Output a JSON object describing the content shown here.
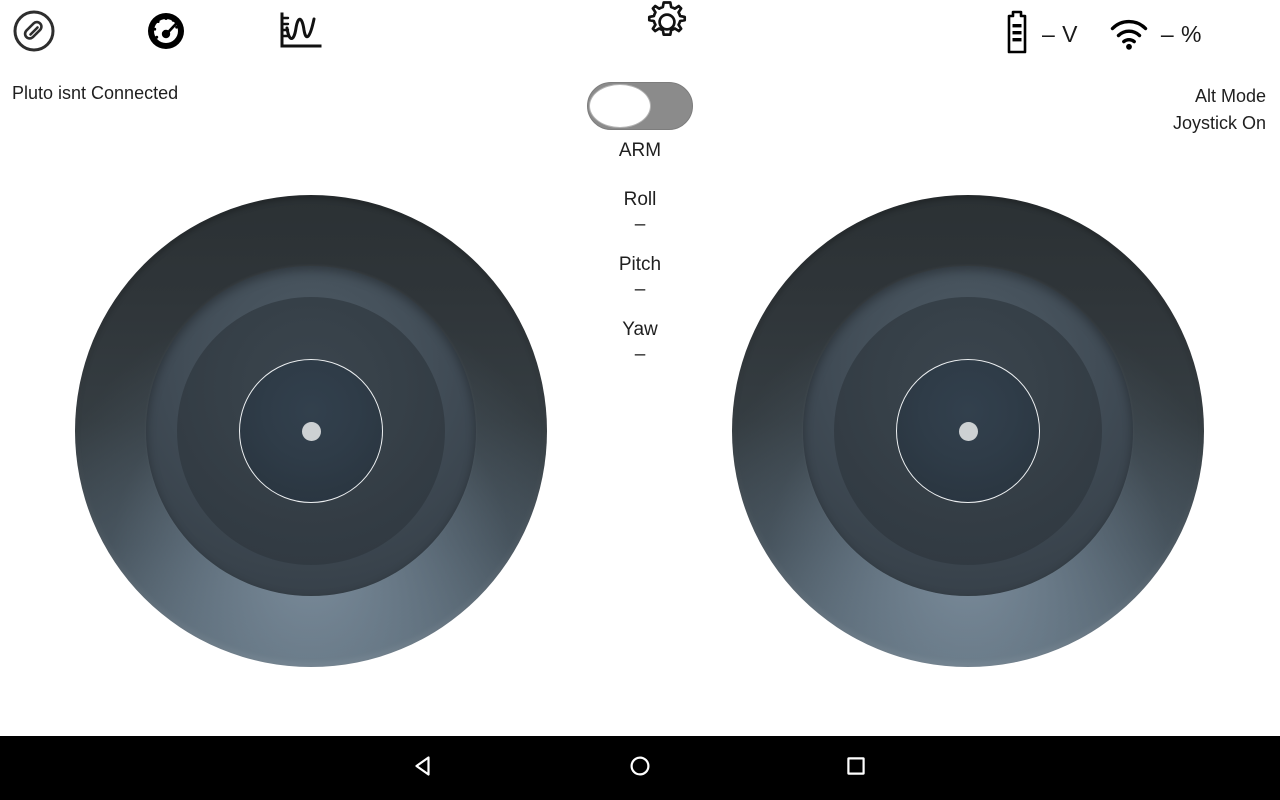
{
  "topbar": {
    "icons": [
      {
        "name": "connect-icon",
        "label": "Connect"
      },
      {
        "name": "gauge-icon",
        "label": "Telemetry Gauge"
      },
      {
        "name": "graph-icon",
        "label": "Graph"
      }
    ],
    "battery": {
      "icon": "battery-icon",
      "value": "– V"
    },
    "signal": {
      "icon": "wifi-icon",
      "value": "– %"
    },
    "settings": {
      "icon": "gear-icon",
      "label": "Settings"
    }
  },
  "status": {
    "connection": "Pluto isnt Connected",
    "mode_line1": "Alt Mode",
    "mode_line2": "Joystick On"
  },
  "arm": {
    "label": "ARM",
    "state": "off"
  },
  "telemetry": [
    {
      "name": "Roll",
      "value": "–"
    },
    {
      "name": "Pitch",
      "value": "–"
    },
    {
      "name": "Yaw",
      "value": "–"
    }
  ],
  "joysticks": [
    {
      "id": "left",
      "name": "left-joystick",
      "dot_x": 0,
      "dot_y": 0
    },
    {
      "id": "right",
      "name": "right-joystick",
      "dot_x": 0,
      "dot_y": 0
    }
  ],
  "navbar": {
    "back": "Back",
    "home": "Home",
    "recents": "Recent apps"
  },
  "colors": {
    "background": "#ffffff",
    "text": "#1f1f1f",
    "icon": "#000000",
    "joystick_rim_dark": "#2b3134",
    "joystick_rim_light": "#5d6d78",
    "joystick_mid": "#47535d",
    "joystick_inner": "#333c44",
    "joystick_thumb": "#2f3c48",
    "joystick_dot": "#cdd1d3",
    "toggle_track_off": "#8b8b8b",
    "toggle_knob": "#ffffff",
    "navbar": "#000000"
  }
}
